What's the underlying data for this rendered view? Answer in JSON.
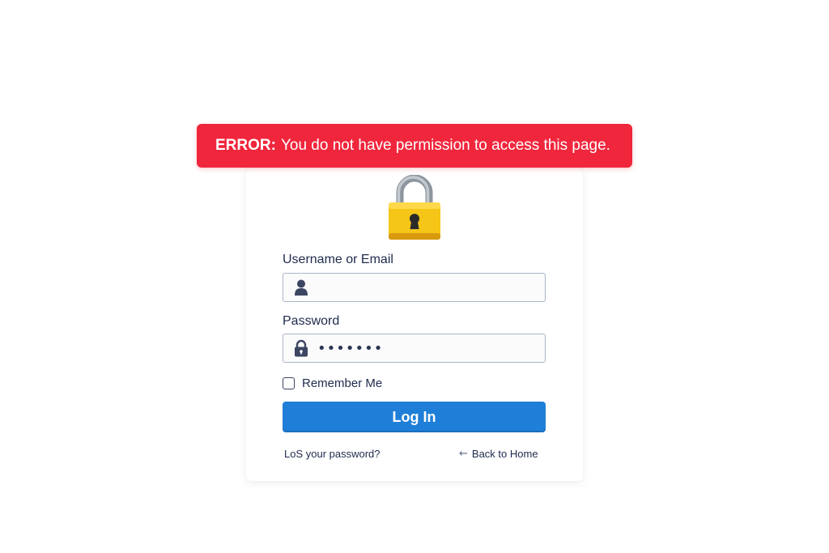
{
  "error": {
    "label": "ERROR:",
    "message": "You do not have permission to access this page."
  },
  "form": {
    "username_label": "Username or Email",
    "username_value": "",
    "username_icon": "user-icon",
    "password_label": "Password",
    "password_value": "•••••••",
    "password_icon": "padlock-icon",
    "remember_label": "Remember Me",
    "remember_checked": false,
    "login_label": "Log In"
  },
  "links": {
    "lost_password": "LoS your password?",
    "back_arrow": "←",
    "back_home": "Back to Home"
  },
  "colors": {
    "error_bg": "#f0263c",
    "button_bg": "#1f7fd8",
    "lock_body": "#f5c518",
    "lock_shackle": "#9aa3ad"
  }
}
